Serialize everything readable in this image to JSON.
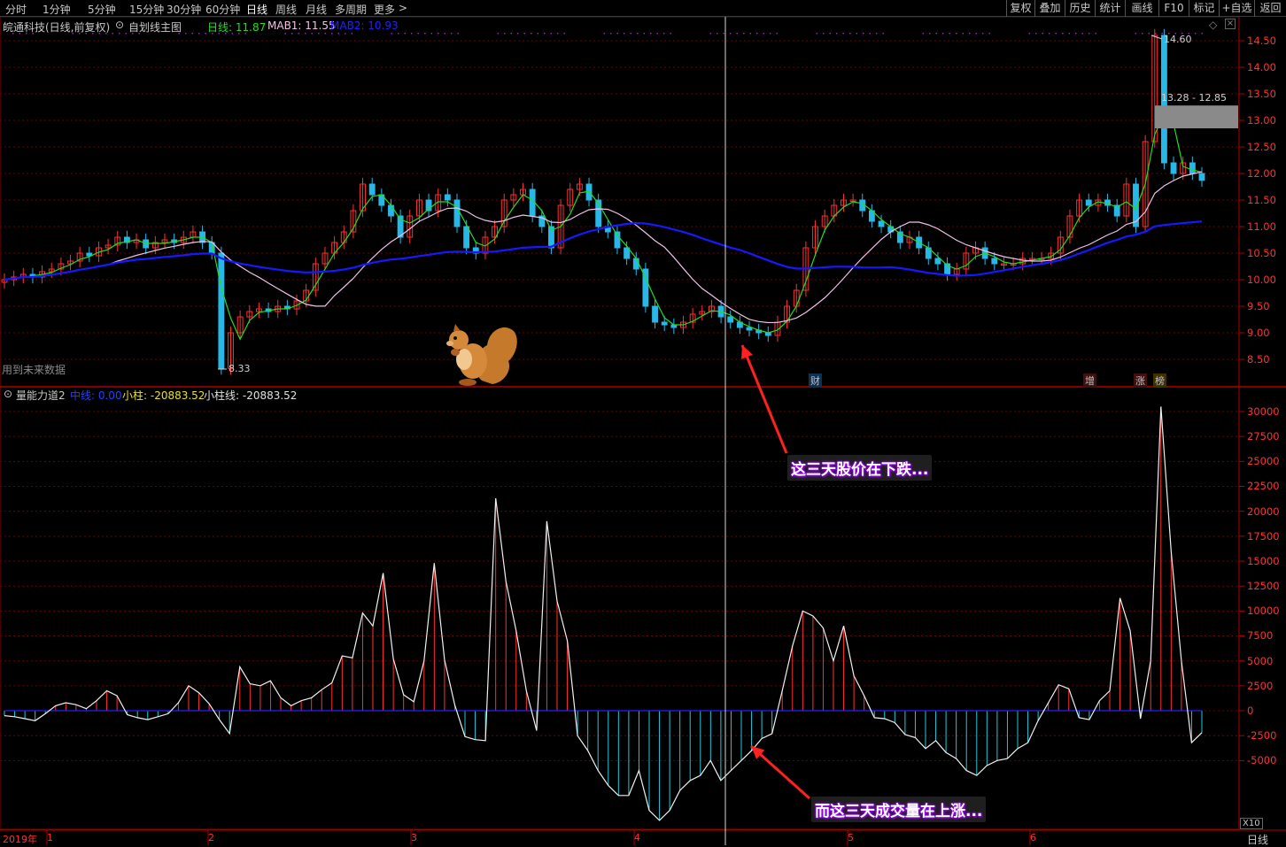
{
  "toolbar": {
    "left_tabs": [
      "分时",
      "1分钟",
      "5分钟",
      "15分钟",
      "30分钟",
      "60分钟",
      "日线",
      "周线",
      "月线",
      "多周期",
      "更多"
    ],
    "active_tab": "日线",
    "right_buttons": [
      "复权",
      "叠加",
      "历史",
      "统计",
      "画线",
      "F10",
      "标记",
      "+自选",
      "返回"
    ]
  },
  "main_header": {
    "stock": "皖通科技(日线,前复权)",
    "indicator": "自划线主图",
    "day_label": "日线: 11.87",
    "mab1_label": "MAB1: 11.55",
    "mab2_label": "MAB2: 10.93"
  },
  "future_data_note": "用到未来数据",
  "price_axis": [
    "14.50",
    "14.00",
    "13.50",
    "13.00",
    "12.50",
    "12.00",
    "11.50",
    "11.00",
    "10.50",
    "10.00",
    "9.50",
    "9.00",
    "8.50"
  ],
  "high_label": "14.60",
  "low_label": "8.33",
  "gap_label": "13.28 - 12.85",
  "events": [
    {
      "text": "财",
      "color": "#4aa3ff"
    },
    {
      "text": "增",
      "color": "#ff4040"
    },
    {
      "text": "涨",
      "color": "#ff4040"
    },
    {
      "text": "榜",
      "color": "#e8a000"
    }
  ],
  "sub_header": {
    "name": "量能力道2",
    "mid_label": "中线: 0.00",
    "bar_label": "小柱: -20883.52",
    "line_label": "小柱线: -20883.52"
  },
  "volume_axis": [
    "30000",
    "27500",
    "25000",
    "22500",
    "20000",
    "17500",
    "15000",
    "12500",
    "10000",
    "7500",
    "5000",
    "2500",
    "0",
    "-2500",
    "-5000"
  ],
  "x_axis": [
    "2019年",
    "1",
    "2",
    "3",
    "4",
    "5",
    "6"
  ],
  "multiplier": "X10",
  "period_label": "日线",
  "annotations": {
    "top": "这三天股价在下跌...",
    "bottom": "而这三天成交量在上涨..."
  },
  "colors": {
    "up": "#ff3030",
    "down": "#28b8e8",
    "grid": "#8b0000",
    "ma_pink": "#f0c0e8",
    "ma_blue": "#1818ff",
    "ma_green": "#22dd22",
    "purple": "#c000ff"
  },
  "chart_data": [
    {
      "type": "candlestick",
      "title": "皖通科技(日线,前复权)",
      "ylim": [
        8.2,
        14.8
      ],
      "close_series": [
        10.0,
        10.05,
        10.1,
        10.05,
        10.15,
        10.2,
        10.3,
        10.35,
        10.5,
        10.45,
        10.6,
        10.65,
        10.8,
        10.7,
        10.75,
        10.6,
        10.7,
        10.75,
        10.7,
        10.8,
        10.9,
        10.7,
        10.5,
        8.33,
        9.0,
        9.3,
        9.4,
        9.45,
        9.4,
        9.5,
        9.45,
        9.6,
        9.8,
        10.3,
        10.5,
        10.7,
        10.9,
        11.3,
        11.8,
        11.6,
        11.4,
        11.2,
        10.8,
        11.2,
        11.5,
        11.3,
        11.6,
        11.5,
        11.0,
        10.6,
        10.5,
        10.8,
        11.0,
        11.5,
        11.6,
        11.7,
        11.2,
        11.0,
        10.6,
        11.4,
        11.7,
        11.8,
        11.5,
        11.0,
        10.9,
        10.6,
        10.4,
        10.2,
        9.5,
        9.2,
        9.15,
        9.1,
        9.2,
        9.35,
        9.4,
        9.5,
        9.3,
        9.2,
        9.1,
        9.05,
        9.0,
        8.95,
        9.2,
        9.5,
        9.8,
        10.6,
        11.0,
        11.2,
        11.4,
        11.5,
        11.5,
        11.3,
        11.1,
        11.0,
        10.9,
        10.7,
        10.8,
        10.6,
        10.4,
        10.3,
        10.1,
        10.2,
        10.5,
        10.6,
        10.4,
        10.3,
        10.3,
        10.3,
        10.4,
        10.4,
        10.4,
        10.5,
        10.8,
        11.2,
        11.5,
        11.4,
        11.5,
        11.4,
        11.2,
        11.8,
        11.0,
        12.6,
        14.6,
        12.2,
        12.0,
        12.2,
        12.0,
        11.87
      ]
    },
    {
      "type": "bar",
      "title": "量能力道2",
      "ylim": [
        -11000,
        31000
      ],
      "values": [
        -500,
        -600,
        -800,
        -1000,
        -300,
        500,
        800,
        600,
        200,
        1000,
        2000,
        1500,
        -400,
        -700,
        -900,
        -600,
        -300,
        800,
        2500,
        1800,
        700,
        -900,
        -2300,
        4400,
        2700,
        2500,
        3000,
        1300,
        500,
        1000,
        1300,
        2100,
        2800,
        5500,
        5300,
        9800,
        8500,
        13800,
        5200,
        1600,
        900,
        5000,
        14800,
        5100,
        600,
        -2600,
        -2900,
        -3000,
        21300,
        13000,
        8000,
        2000,
        -2000,
        19000,
        11000,
        7000,
        -2500,
        -4000,
        -6000,
        -7500,
        -8500,
        -8500,
        -6000,
        -10000,
        -11000,
        -10000,
        -8000,
        -7000,
        -6500,
        -5000,
        -7000,
        -6000,
        -5000,
        -4000,
        -2800,
        -2300,
        2000,
        6500,
        10000,
        9500,
        8300,
        5000,
        8500,
        3500,
        1500,
        -700,
        -800,
        -1200,
        -2400,
        -2700,
        -3800,
        -3000,
        -4200,
        -4800,
        -6000,
        -6500,
        -5500,
        -5000,
        -4800,
        -3800,
        -3200,
        -1000,
        800,
        2600,
        2200,
        -700,
        -900,
        1000,
        2000,
        11300,
        8000,
        -800,
        5000,
        30500,
        16000,
        5000,
        -3200,
        -2200
      ]
    }
  ]
}
